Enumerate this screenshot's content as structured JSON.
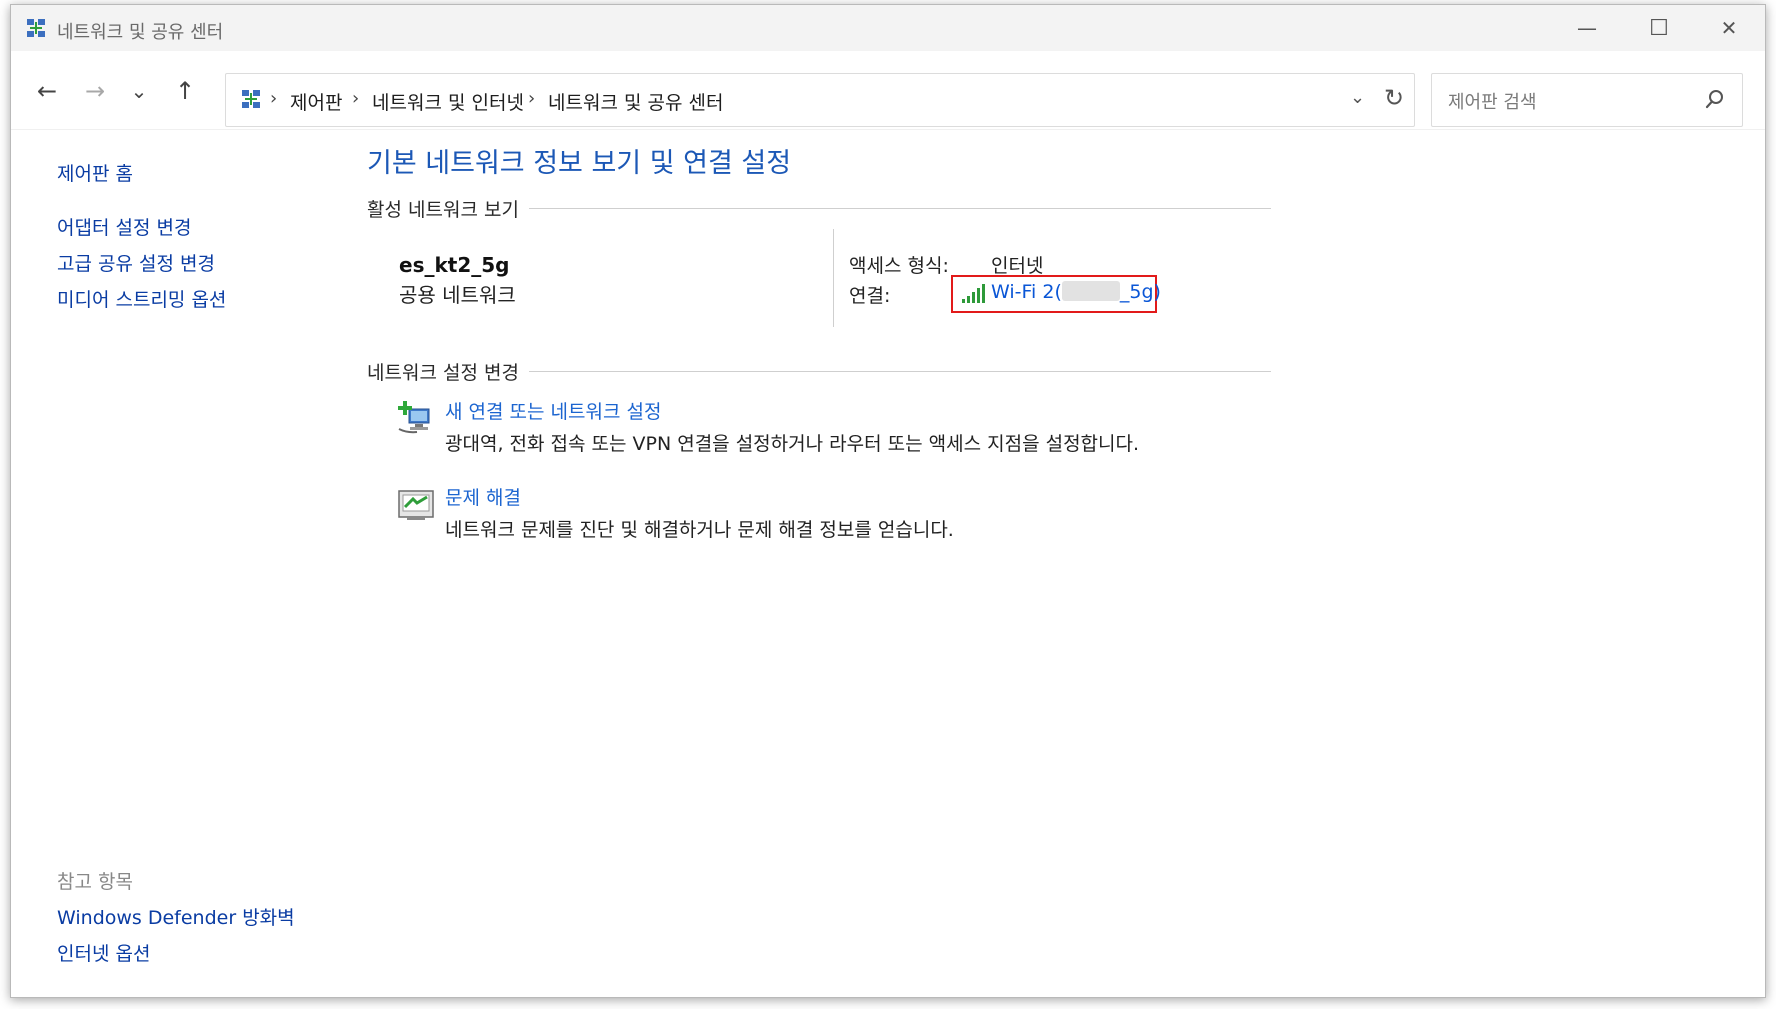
{
  "window": {
    "title": "네트워크 및 공유 센터",
    "minimize_glyph": "—",
    "maximize_glyph": "☐",
    "close_glyph": "✕"
  },
  "nav": {
    "back_glyph": "←",
    "forward_glyph": "→",
    "recent_glyph": "⌄",
    "up_glyph": "↑",
    "breadcrumb": [
      "제어판",
      "네트워크 및 인터넷",
      "네트워크 및 공유 센터"
    ],
    "separator": "›",
    "dropdown_glyph": "⌄",
    "refresh_glyph": "↻",
    "search_placeholder": "제어판 검색"
  },
  "sidebar": {
    "home": "제어판 홈",
    "items": [
      "어댑터 설정 변경",
      "고급 공유 설정 변경",
      "미디어 스트리밍 옵션"
    ],
    "see_also_label": "참고 항목",
    "see_also": [
      "Windows Defender 방화벽",
      "인터넷 옵션"
    ]
  },
  "main": {
    "title": "기본 네트워크 정보 보기 및 연결 설정",
    "active_section": "활성 네트워크 보기",
    "network_name": "es_kt2_5g",
    "network_type": "공용 네트워크",
    "access_label": "액세스 형식:",
    "access_value": "인터넷",
    "connection_label": "연결:",
    "connection_prefix": "Wi-Fi 2(",
    "connection_suffix": "_5g)",
    "change_section": "네트워크 설정 변경",
    "tasks": [
      {
        "title": "새 연결 또는 네트워크 설정",
        "desc": "광대역, 전화 접속 또는 VPN 연결을 설정하거나 라우터 또는 액세스 지점을 설정합니다."
      },
      {
        "title": "문제 해결",
        "desc": "네트워크 문제를 진단 및 해결하거나 문제 해결 정보를 얻습니다."
      }
    ]
  },
  "icons": {
    "app": "network-center-icon",
    "search": "search-icon",
    "wifi": "wifi-signal-icon",
    "new_connection": "new-connection-icon",
    "troubleshoot": "troubleshoot-icon"
  },
  "colors": {
    "link": "#0a3ca3",
    "title": "#1c58b6",
    "highlight": "#e21a1a"
  }
}
